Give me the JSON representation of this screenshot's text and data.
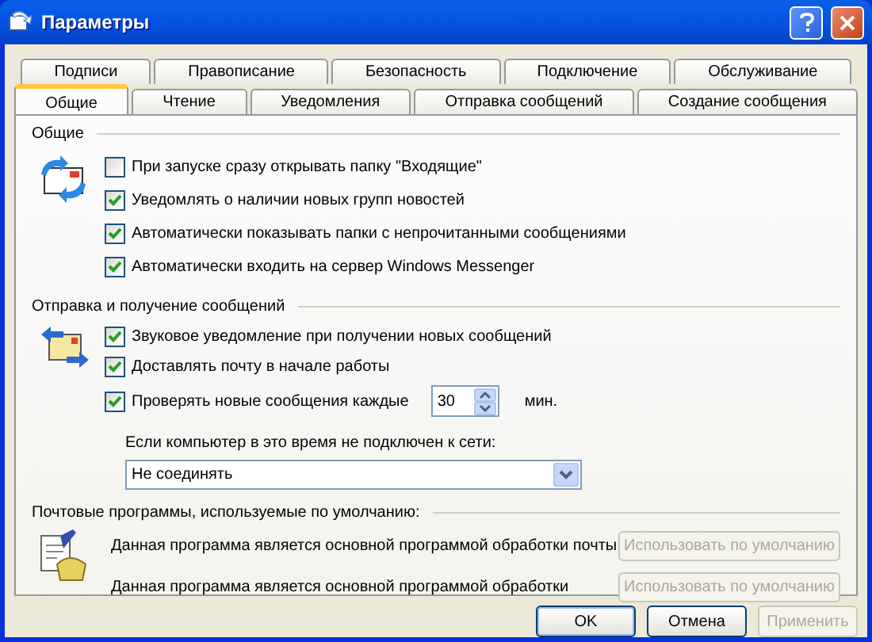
{
  "window": {
    "title": "Параметры"
  },
  "tabs_row_1": [
    {
      "label": "Подписи",
      "selected": false
    },
    {
      "label": "Правописание",
      "selected": false
    },
    {
      "label": "Безопасность",
      "selected": false
    },
    {
      "label": "Подключение",
      "selected": false
    },
    {
      "label": "Обслуживание",
      "selected": false
    }
  ],
  "tabs_row_2": [
    {
      "label": "Общие",
      "selected": true
    },
    {
      "label": "Чтение",
      "selected": false
    },
    {
      "label": "Уведомления",
      "selected": false
    },
    {
      "label": "Отправка сообщений",
      "selected": false
    },
    {
      "label": "Создание сообщения",
      "selected": false
    }
  ],
  "general": {
    "title": "Общие",
    "items": [
      {
        "label": "При запуске сразу открывать папку \"Входящие\"",
        "checked": false
      },
      {
        "label": "Уведомлять о наличии новых групп новостей",
        "checked": true
      },
      {
        "label": "Автоматически показывать папки с непрочитанными сообщениями",
        "checked": true
      },
      {
        "label": "Автоматически входить на сервер Windows Messenger",
        "checked": true
      }
    ]
  },
  "send_receive": {
    "title": "Отправка и получение сообщений",
    "items": [
      {
        "kind": "checkbox",
        "label": "Звуковое уведомление при получении новых сообщений",
        "checked": true
      },
      {
        "kind": "checkbox",
        "label": "Доставлять почту в начале работы",
        "checked": true
      },
      {
        "kind": "interval",
        "label": "Проверять новые сообщения каждые",
        "checked": true,
        "value": "30",
        "unit": "мин."
      }
    ],
    "offline_label": "Если компьютер в это время не подключен к сети:",
    "offline_select": {
      "value": "Не соединять"
    }
  },
  "default_programs": {
    "title": "Почтовые программы, используемые по умолчанию:",
    "rows": [
      {
        "text": "Данная программа является основной программой обработки почты",
        "button": "Использовать по умолчанию",
        "disabled": true
      },
      {
        "text": "Данная программа является основной программой обработки",
        "button": "Использовать по умолчанию",
        "disabled": true
      }
    ]
  },
  "buttons": [
    {
      "label": "OK",
      "disabled": false,
      "default": true
    },
    {
      "label": "Отмена",
      "disabled": false,
      "default": false
    },
    {
      "label": "Применить",
      "disabled": true,
      "default": false
    }
  ]
}
